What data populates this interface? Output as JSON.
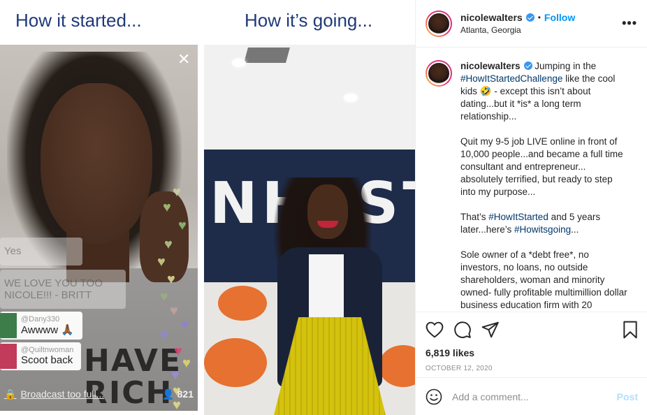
{
  "image": {
    "caption_left": "How it started...",
    "caption_right": "How it’s going...",
    "live": {
      "comments": [
        {
          "user": "",
          "msg": "Yes"
        },
        {
          "user": "",
          "msg": "WE LOVE YOU TOO NICOLE!!! - BRITT"
        },
        {
          "user": "@Dany330",
          "msg": "Awwww 🙏🏾"
        },
        {
          "user": "@Quiltnwoman",
          "msg": "Scoot back"
        }
      ],
      "broadcast_text": "Broadcast too full...",
      "viewer_count": "821",
      "shirt_text": "HAVE\nRICH"
    },
    "wall_text": "NHEST"
  },
  "post": {
    "username": "nicolewalters",
    "follow_label": "Follow",
    "location": "Atlanta, Georgia",
    "more_label": "•••",
    "caption": {
      "username": "nicolewalters",
      "p1_a": " Jumping in the ",
      "p1_tag": "#HowItStartedChallenge",
      "p1_b": " like the cool kids 🤣 - except this isn’t about dating...but it *is* a long term relationship...",
      "p2": "Quit my 9-5 job LIVE online in front of 10,000 people...and became a full time consultant and entrepreneur... absolutely terrified, but ready to step into my purpose...",
      "p3_a": "That’s ",
      "p3_tag1": "#HowItStarted",
      "p3_b": " and 5 years later...here’s ",
      "p3_tag2": "#Howitsgoing",
      "p3_c": "...",
      "p4": "Sole owner of a *debt free*, no investors, no loans, no outside shareholders, woman and minority owned- fully profitable multimillion dollar business education firm with 20"
    },
    "likes": "6,819 likes",
    "date": "OCTOBER 12, 2020",
    "comment_placeholder": "Add a comment...",
    "post_label": "Post",
    "colors": {
      "link": "#0095f6",
      "hashtag": "#00376b",
      "verified": "#3897f0",
      "post_disabled": "#b2dffc"
    },
    "icons": [
      "heart-icon",
      "comment-icon",
      "share-icon",
      "bookmark-icon",
      "emoji-icon",
      "verified-icon",
      "close-icon",
      "user-icon",
      "lock-icon"
    ]
  }
}
